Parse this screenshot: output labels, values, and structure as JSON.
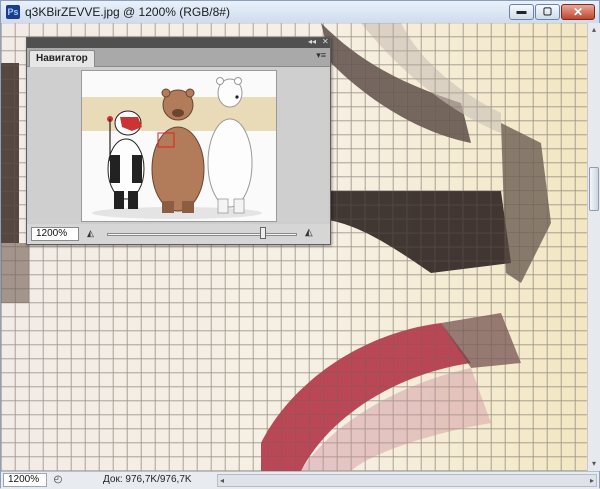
{
  "window": {
    "app_icon": "photoshop-logo-icon",
    "app_icon_text": "Ps",
    "title": "q3KBirZEVVE.jpg @ 1200% (RGB/8#)",
    "minimize_glyph": "▬",
    "maximize_glyph": "▢",
    "close_glyph": "✕"
  },
  "navigator": {
    "tab_label": "Навигатор",
    "collapse_glyph": "◂◂",
    "close_glyph": "✕",
    "menu_glyph": "▾≡",
    "zoom_value": "1200%",
    "zoom_out_glyph": "◭",
    "zoom_in_glyph": "◭"
  },
  "status": {
    "zoom_value": "1200%",
    "icon": "document-info-icon",
    "doc_info": "Док: 976,7K/976,7K",
    "arrow_glyph": "▸",
    "scroll_left": "◂",
    "scroll_right": "▸"
  },
  "scrollbar": {
    "up": "▴",
    "down": "▾"
  },
  "colors": {
    "accent": "#1e3c8c",
    "canvas_cream": "#f3e7c2",
    "pixel_dark": "#3a2a24",
    "pixel_red": "#b23446"
  }
}
